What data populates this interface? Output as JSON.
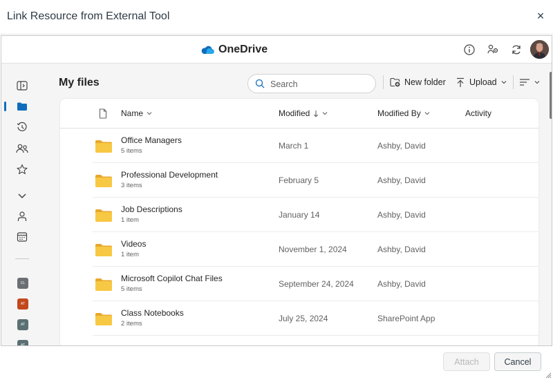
{
  "dialog": {
    "title": "Link Resource from External Tool",
    "close_glyph": "×",
    "close_icon": "close-icon"
  },
  "onedrive": {
    "brand": "OneDrive",
    "brand_icon": "onedrive-cloud-icon",
    "brand_color": "#0f6cbd",
    "top_icons": [
      "info-icon",
      "people-settings-icon",
      "sync-icon"
    ],
    "avatar": "avatar"
  },
  "rail": {
    "items": [
      "collapse-nav-icon",
      "my-files-folder-icon",
      "recent-icon",
      "shared-icon",
      "favorites-star-icon",
      "more-chevron-icon",
      "people-icon",
      "meetings-calendar-icon"
    ],
    "active_color": "#0f6cbd",
    "sites": [
      {
        "initials": "CL",
        "color": "#6b6f73"
      },
      {
        "initials": "AT",
        "color": "#c2491d"
      },
      {
        "initials": "AT",
        "color": "#5b7073"
      },
      {
        "initials": "AT",
        "color": "#5b7073"
      },
      {
        "initials": "AT",
        "color": "#5b7073"
      }
    ]
  },
  "main": {
    "title": "My files",
    "search": {
      "placeholder": "Search"
    },
    "toolbar": {
      "new_folder": "New folder",
      "upload": "Upload"
    }
  },
  "table": {
    "columns": {
      "name": "Name",
      "modified": "Modified",
      "modified_by": "Modified By",
      "activity": "Activity"
    },
    "rows": [
      {
        "name": "Office Managers",
        "count": "5 items",
        "modified": "March 1",
        "modified_by": "Ashby, David"
      },
      {
        "name": "Professional Development",
        "count": "3 items",
        "modified": "February 5",
        "modified_by": "Ashby, David"
      },
      {
        "name": "Job Descriptions",
        "count": "1 item",
        "modified": "January 14",
        "modified_by": "Ashby, David"
      },
      {
        "name": "Videos",
        "count": "1 item",
        "modified": "November 1, 2024",
        "modified_by": "Ashby, David"
      },
      {
        "name": "Microsoft Copilot Chat Files",
        "count": "5 items",
        "modified": "September 24, 2024",
        "modified_by": "Ashby, David"
      },
      {
        "name": "Class Notebooks",
        "count": "2 items",
        "modified": "July 25, 2024",
        "modified_by": "SharePoint App"
      }
    ],
    "folder_color": "#f7c843"
  },
  "footer": {
    "attach": "Attach",
    "cancel": "Cancel"
  }
}
